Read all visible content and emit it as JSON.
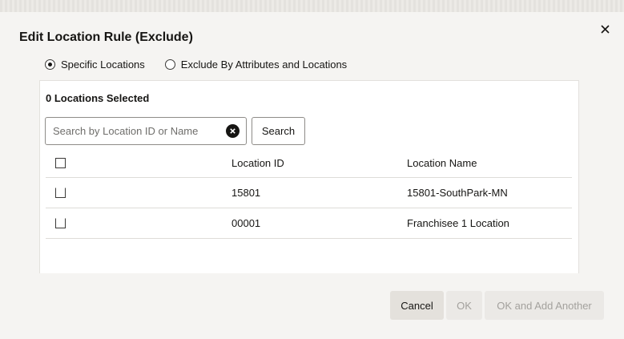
{
  "dialog": {
    "title": "Edit Location Rule (Exclude)"
  },
  "radios": [
    {
      "label": "Specific Locations",
      "checked": true
    },
    {
      "label": "Exclude By Attributes and Locations",
      "checked": false
    }
  ],
  "panel": {
    "selected_count": "0 Locations Selected",
    "search": {
      "placeholder": "Search by Location ID or Name",
      "value": "",
      "button_label": "Search"
    },
    "table": {
      "columns": [
        "",
        "Location ID",
        "Location Name"
      ],
      "rows": [
        {
          "id": "15801",
          "name": "15801-SouthPark-MN",
          "selected": false
        },
        {
          "id": "00001",
          "name": "Franchisee 1 Location",
          "selected": false
        }
      ]
    }
  },
  "footer": {
    "cancel_label": "Cancel",
    "ok_label": "OK",
    "ok_add_label": "OK and Add Another"
  },
  "icons": {
    "close": "close-icon",
    "clear": "clear-search-icon"
  }
}
